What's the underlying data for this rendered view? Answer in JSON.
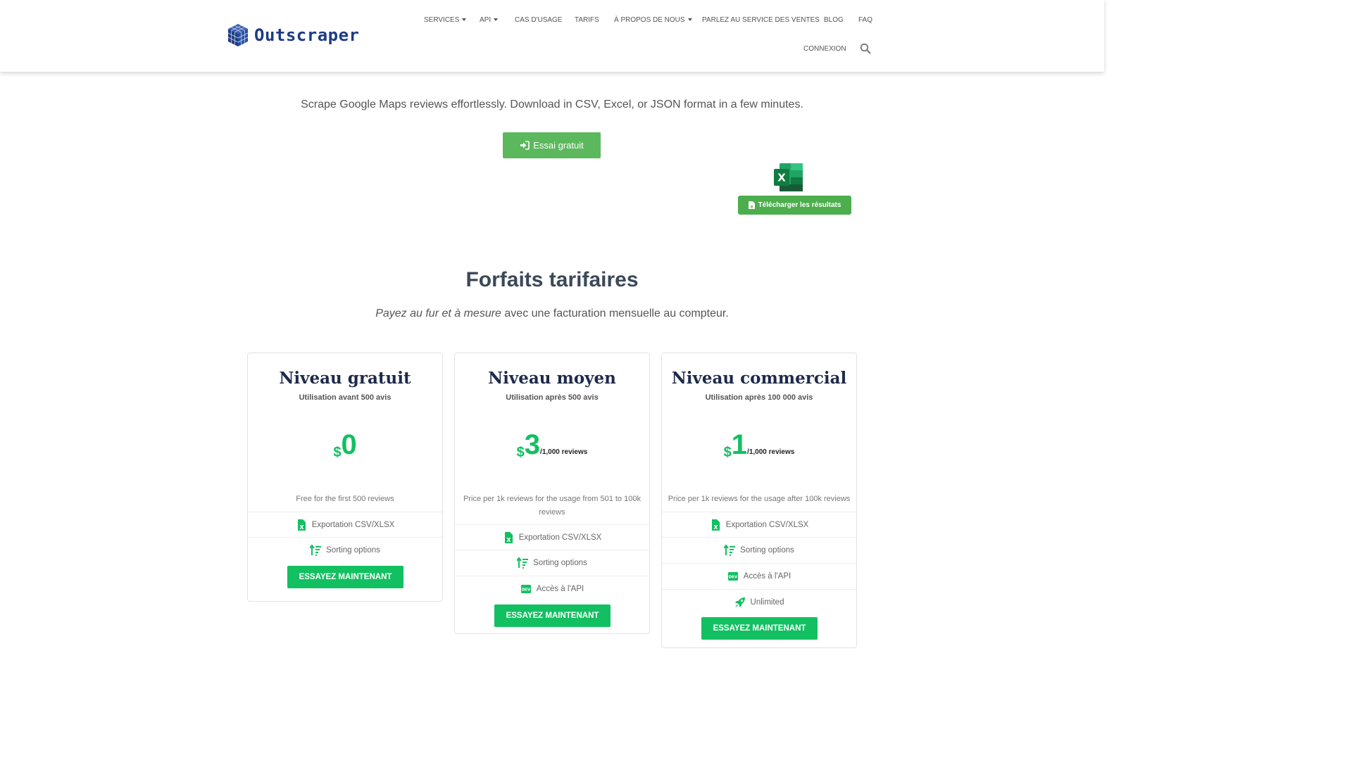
{
  "header": {
    "logo_text": "Outscraper",
    "nav": [
      {
        "label": "SERVICES",
        "dropdown": true
      },
      {
        "label": "API",
        "dropdown": true
      },
      {
        "label": "CAS D'USAGE",
        "dropdown": false
      },
      {
        "label": "TARIFS",
        "dropdown": false
      },
      {
        "label": "À PROPOS DE NOUS",
        "dropdown": true
      },
      {
        "label": "PARLEZ AU SERVICE DES VENTES",
        "dropdown": false
      },
      {
        "label": "BLOG",
        "dropdown": false
      },
      {
        "label": "FAQ",
        "dropdown": false
      },
      {
        "label": "CONNEXION",
        "dropdown": false
      }
    ],
    "search_icon": "search-icon"
  },
  "hero": {
    "subtitle": "Scrape Google Maps reviews effortlessly. Download in CSV, Excel, or JSON format in a few minutes.",
    "trial_button": "Essai gratuit",
    "download_button": "Télécharger les résultats"
  },
  "pricing": {
    "title": "Forfaits tarifaires",
    "subtitle_em": "Payez au fur et à mesure",
    "subtitle_rest": " avec une facturation mensuelle au compteur.",
    "plans": [
      {
        "name": "Niveau gratuit",
        "usage": "Utilisation avant 500 avis",
        "currency": "$",
        "price": "0",
        "per": "",
        "description": "Free for the first 500 reviews",
        "features": [
          {
            "icon": "excel-file-icon",
            "label": "Exportation CSV/XLSX"
          },
          {
            "icon": "sort-icon",
            "label": "Sorting options"
          }
        ],
        "button": "ESSAYEZ MAINTENANT"
      },
      {
        "name": "Niveau moyen",
        "usage": "Utilisation après 500 avis",
        "currency": "$",
        "price": "3",
        "per": "/1,000 reviews",
        "description": "Price per 1k reviews for the usage from 501 to 100k reviews",
        "features": [
          {
            "icon": "excel-file-icon",
            "label": "Exportation CSV/XLSX"
          },
          {
            "icon": "sort-icon",
            "label": "Sorting options"
          },
          {
            "icon": "dev-icon",
            "label": "Accès à l'API"
          }
        ],
        "button": "ESSAYEZ MAINTENANT"
      },
      {
        "name": "Niveau commercial",
        "usage": "Utilisation après 100 000 avis",
        "currency": "$",
        "price": "1",
        "per": "/1,000 reviews",
        "description": "Price per 1k reviews for the usage after 100k reviews",
        "features": [
          {
            "icon": "excel-file-icon",
            "label": "Exportation CSV/XLSX"
          },
          {
            "icon": "sort-icon",
            "label": "Sorting options"
          },
          {
            "icon": "dev-icon",
            "label": "Accès à l'API"
          },
          {
            "icon": "rocket-icon",
            "label": "Unlimited"
          }
        ],
        "button": "ESSAYEZ MAINTENANT"
      }
    ]
  },
  "colors": {
    "brand_blue": "#1d3b85",
    "green_primary": "#12c061",
    "green_button": "#5cb85c"
  }
}
